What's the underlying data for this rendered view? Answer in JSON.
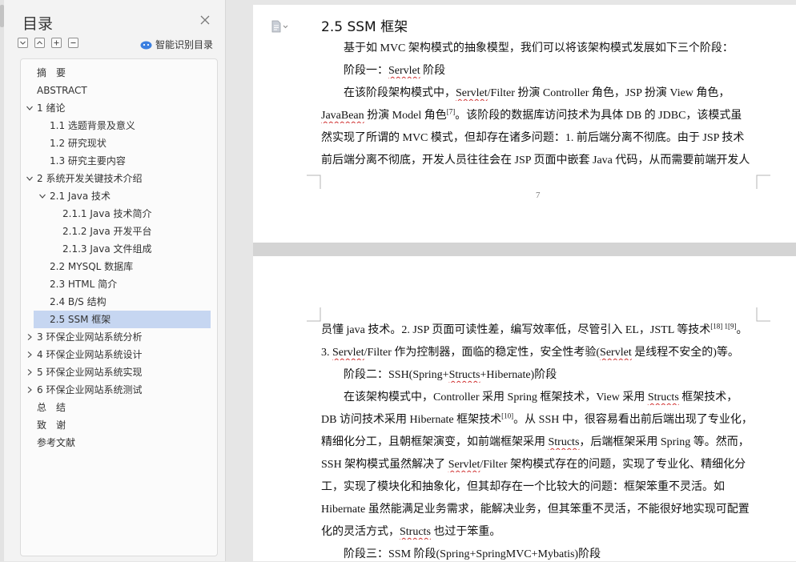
{
  "toc_panel": {
    "title": "目录",
    "smart_label": "智能识别目录",
    "items": [
      {
        "label": "摘　要"
      },
      {
        "label": "ABSTRACT"
      },
      {
        "label": "1 绪论"
      },
      {
        "label": "1.1 选题背景及意义"
      },
      {
        "label": "1.2 研究现状"
      },
      {
        "label": "1.3 研究主要内容"
      },
      {
        "label": "2 系统开发关键技术介绍"
      },
      {
        "label": "2.1 Java 技术"
      },
      {
        "label": "2.1.1 Java 技术简介"
      },
      {
        "label": "2.1.2 Java 开发平台"
      },
      {
        "label": "2.1.3 Java 文件组成"
      },
      {
        "label": "2.2 MYSQL 数据库"
      },
      {
        "label": "2.3 HTML 简介"
      },
      {
        "label": "2.4 B/S 结构"
      },
      {
        "label": "2.5 SSM 框架"
      },
      {
        "label": "3 环保企业网站系统分析"
      },
      {
        "label": "4 环保企业网站系统设计"
      },
      {
        "label": "5 环保企业网站系统实现"
      },
      {
        "label": "6 环保企业网站系统测试"
      },
      {
        "label": "总　结"
      },
      {
        "label": "致　谢"
      },
      {
        "label": "参考文献"
      }
    ]
  },
  "document": {
    "page1": {
      "heading": "2.5 SSM 框架",
      "page_number": "7",
      "lines": [
        "基于如 MVC 架构模式的抽象模型，我们可以将该架构模式发展如下三个阶段：",
        "阶段一：",
        "Servlet",
        " 阶段",
        "在该阶段架构模式中，",
        "Servlet",
        "/Filter 扮演 Controller 角色，JSP 扮演 View 角色，",
        "JavaBean",
        " 扮演 Model 角色",
        "[7]",
        "。该阶段的数据库访问技术为具体 DB 的 JDBC，该模式虽",
        "然实现了所谓的 MVC 模式，但却存在诸多问题：1. 前后端分离不彻底。由于 JSP 技术",
        "前后端分离不彻底，开发人员往往会在 JSP 页面中嵌套 Java 代码，从而需要前端开发人"
      ]
    },
    "page2": {
      "lines": [
        "员懂 java 技术。2. JSP 页面可读性差，编写效率低，尽管引入 EL，JSTL 等技术",
        "[18] 1[9]",
        "。",
        "3. ",
        "Servlet",
        "/Filter 作为控制器，面临的稳定性，安全性考验(",
        "Servlet",
        " 是线程不安全的)等。",
        "阶段二：SSH(Spring+",
        "Structs",
        "+Hibernate)阶段",
        "在该架构模式中，Controller 采用 Spring 框架技术，View 采用 ",
        "Structs",
        " 框架技术，",
        "DB 访问技术采用 Hibernate 框架技术",
        "[10]",
        "。从 SSH 中，很容易看出前后端出现了专业化，",
        "精细化分工，且朝框架演变，如前端框架采用 ",
        "Structs",
        "，后端框架采用 Spring 等。然而，",
        "SSH 架构模式虽然解决了 ",
        "Servlet",
        "/Filter 架构模式存在的问题，实现了专业化、精细化分",
        "工，实现了模块化和抽象化，但其却存在一个比较大的问题：框架笨重不灵活。如",
        "Hibernate 虽然能满足业务需求，能解决业务，但其笨重不灵活，不能很好地实现可配置",
        "化的灵活方式，",
        "Structs",
        " 也过于笨重。",
        "阶段三：SSM 阶段(Spring+SpringMVC+Mybatis)阶段"
      ]
    }
  },
  "colors": {
    "selected": "#c6d6f1",
    "accent": "#3b7fe0",
    "squiggle": "#d03030"
  }
}
